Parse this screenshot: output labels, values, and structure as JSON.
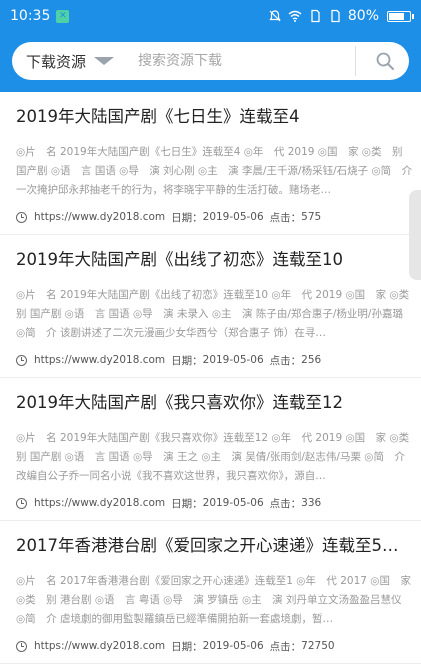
{
  "status_bar": {
    "time": "10:35",
    "battery": "80%",
    "battery_level": 0.8,
    "icons": [
      "dnd-icon",
      "wifi-icon",
      "sim-icon",
      "sim2-icon",
      "battery-icon"
    ]
  },
  "search": {
    "category_label": "下载资源",
    "placeholder": "搜索资源下载",
    "search_button_icon": "magnifier-icon"
  },
  "colors": {
    "header": "#1e8fe6"
  },
  "items": [
    {
      "title": "2019年大陆国产剧《七日生》连载至4",
      "desc": "◎片　名 2019年大陆国产剧《七日生》连载至4 ◎年　代 2019 ◎国　家 ◎类　别 国产剧 ◎语　言 国语 ◎导　演 刘心刚 ◎主　演 李晨/王千源/杨采钰/石烧子 ◎简　介 一次掩护邱永邦抽老千的行为，将李晓宇平静的生活打破。赌场老…",
      "url": "https://www.dy2018.com",
      "date_label": "日期：",
      "date": "2019-05-06",
      "clicks_label": "点击：",
      "clicks": "575"
    },
    {
      "title": "2019年大陆国产剧《出线了初恋》连载至10",
      "desc": "◎片　名 2019年大陆国产剧《出线了初恋》连载至10 ◎年　代 2019 ◎国　家 ◎类　别 国产剧 ◎语　言 国语 ◎导　演 未录入 ◎主　演 陈子由/郑合惠子/杨业明/孙嘉璐 ◎简　介 该剧讲述了二次元漫画少女华西兮（郑合惠子 饰）在寻…",
      "url": "https://www.dy2018.com",
      "date_label": "日期：",
      "date": "2019-05-06",
      "clicks_label": "点击：",
      "clicks": "256"
    },
    {
      "title": "2019年大陆国产剧《我只喜欢你》连载至12",
      "desc": "◎片　名 2019年大陆国产剧《我只喜欢你》连载至12 ◎年　代 2019 ◎国　家 ◎类　别 国产剧 ◎语　言 国语 ◎导　演 王之 ◎主　演 吴倩/张雨剑/赵志伟/马栗 ◎简　介 改编自公子乔一同名小说《我不喜欢这世界，我只喜欢你》，源自…",
      "url": "https://www.dy2018.com",
      "date_label": "日期：",
      "date": "2019-05-06",
      "clicks_label": "点击：",
      "clicks": "336"
    },
    {
      "title": "2017年香港港台剧《爱回家之开心速递》连载至5…",
      "desc": "◎片　名 2017年香港港台剧《爱回家之开心速递》连载至1 ◎年　代 2017 ◎国　家 ◎类　别 港台剧 ◎语　言 粤语 ◎导　演 罗镇岳 ◎主　演 刘丹单立文汤盈盈吕慧仪 ◎简　介 虐境劇的御用監製羅鎮岳已經準備開拍新一套處境劇，暂…",
      "url": "https://www.dy2018.com",
      "date_label": "日期：",
      "date": "2019-05-06",
      "clicks_label": "点击：",
      "clicks": "72750"
    }
  ]
}
